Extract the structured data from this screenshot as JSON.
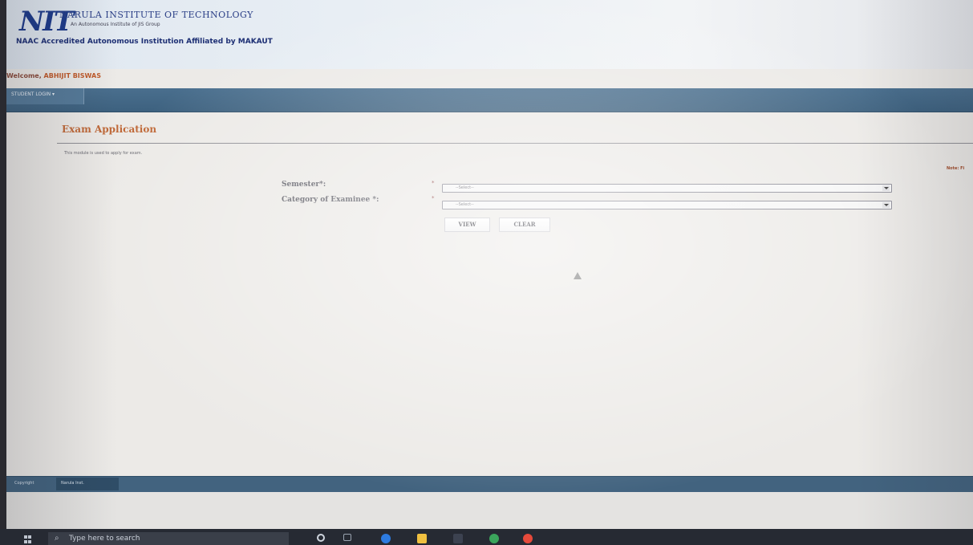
{
  "header": {
    "logo_text": "NIT",
    "institute_name": "NARULA INSTITUTE OF TECHNOLOGY",
    "institute_subtitle": "An Autonomous Institute of JIS Group",
    "accreditation": "NAAC Accredited Autonomous Institution Affiliated by MAKAUT"
  },
  "welcome": {
    "prefix": "Welcome,",
    "user_name": "ABHIJIT BISWAS"
  },
  "nav": {
    "items": [
      {
        "label": "STUDENT LOGIN ▾"
      }
    ]
  },
  "page": {
    "title": "Exam Application",
    "description": "This module is used to apply for exam.",
    "note": "Note: Fi"
  },
  "form": {
    "semester": {
      "label": "Semester*:",
      "required_mark": "*",
      "selected": "--Select--"
    },
    "category": {
      "label": "Category of Examinee *:",
      "required_mark": "*",
      "selected": "--Select--"
    },
    "view_button": "VIEW",
    "clear_button": "CLEAR"
  },
  "footer": {
    "left": "Copyright",
    "link": "Narula Inst."
  },
  "taskbar": {
    "search_placeholder": "Type here to search",
    "icons": [
      {
        "name": "search-icon",
        "color": "#f2f2f2"
      },
      {
        "name": "task-view-icon",
        "color": "#cfd5de"
      },
      {
        "name": "edge-icon",
        "color": "#2d7be0"
      },
      {
        "name": "file-explorer-icon",
        "color": "#f0c040"
      },
      {
        "name": "store-icon",
        "color": "#444a55"
      },
      {
        "name": "chrome-icon",
        "color": "#3ba55c"
      },
      {
        "name": "chrome-profile-icon",
        "color": "#e64a3b"
      }
    ]
  },
  "colors": {
    "nav_bar": "#42637f",
    "title": "#c06a3a",
    "accent_blue": "#1d3b8b"
  }
}
